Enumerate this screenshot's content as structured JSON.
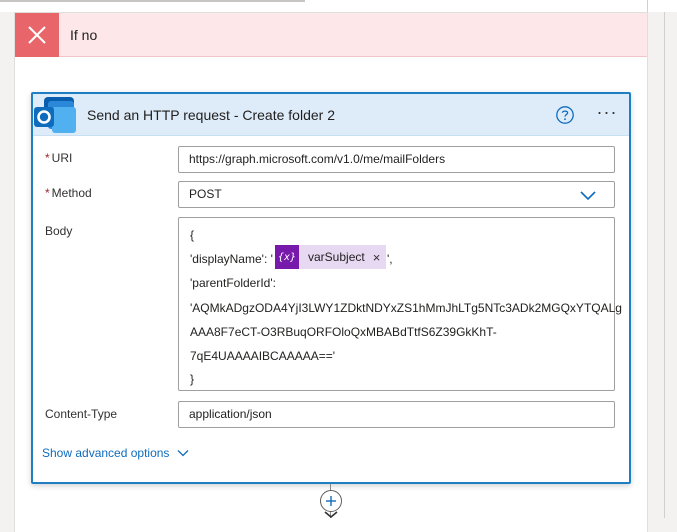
{
  "branch": {
    "title": "If no",
    "icon": "close-icon",
    "header_color": "#fde7e9",
    "icon_color": "#e8656a"
  },
  "action": {
    "title": "Send an HTTP request - Create folder 2",
    "app_icon": "outlook-icon",
    "help_icon": "help-icon",
    "more_icon": "more-options-icon",
    "more_label": "···",
    "accent": "#1f7fc4"
  },
  "fields": {
    "uri": {
      "label": "URI",
      "required_mark": "*",
      "value": "https://graph.microsoft.com/v1.0/me/mailFolders"
    },
    "method": {
      "label": "Method",
      "required_mark": "*",
      "value": "POST"
    },
    "body": {
      "label": "Body",
      "lines": [
        "{",
        "'displayName': '",
        "',",
        "'parentFolderId':",
        "'AQMkADgzODA4YjI3LWY1ZDktNDYxZS1hMmJhLTg5NTc3ADk2MGQxYTQALg",
        "AAA8F7eCT-O3RBuqORFOloQxMBABdTtfS6Z39GkKhT-",
        "7qE4UAAAAIBCAAAAA=='",
        "}"
      ],
      "token": {
        "icon_text": "{x}",
        "label": "varSubject",
        "remove": "×",
        "color": "#7719aa"
      }
    },
    "content_type": {
      "label": "Content-Type",
      "value": "application/json"
    }
  },
  "advanced": {
    "label": "Show advanced options"
  },
  "connector": {
    "add_icon": "plus-icon"
  }
}
